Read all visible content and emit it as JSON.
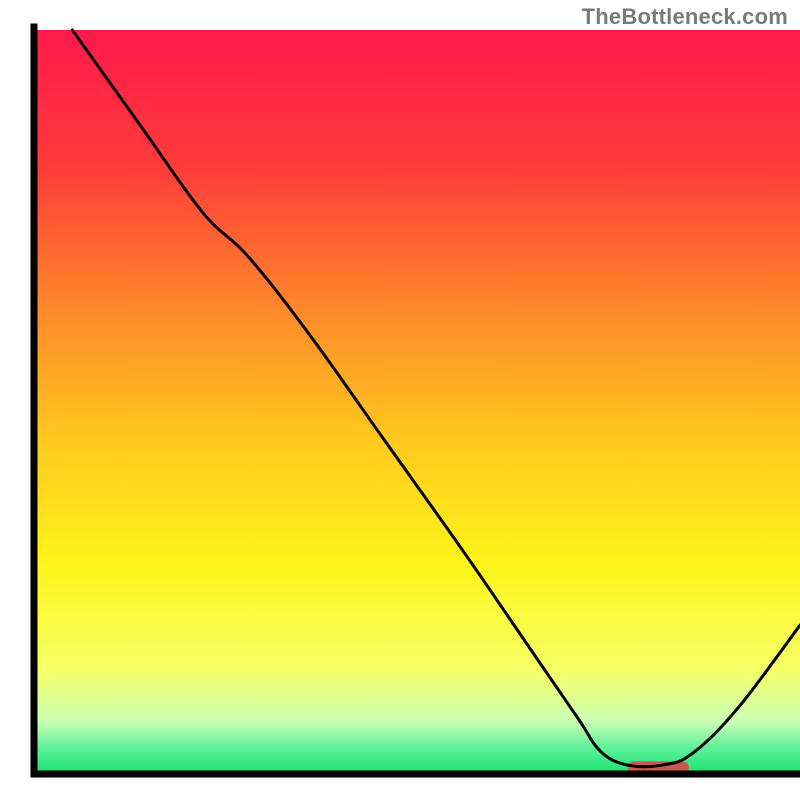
{
  "watermark": "TheBottleneck.com",
  "chart_data": {
    "type": "line",
    "title": "",
    "xlabel": "",
    "ylabel": "",
    "xlim": [
      0,
      100
    ],
    "ylim": [
      0,
      100
    ],
    "grid": false,
    "legend": false,
    "gradient_stops": [
      {
        "offset": 0.0,
        "color": "#ff1a4b"
      },
      {
        "offset": 0.18,
        "color": "#ff3a3a"
      },
      {
        "offset": 0.38,
        "color": "#ff8a2a"
      },
      {
        "offset": 0.55,
        "color": "#ffc81e"
      },
      {
        "offset": 0.72,
        "color": "#fff51a"
      },
      {
        "offset": 0.86,
        "color": "#f6ff66"
      },
      {
        "offset": 0.93,
        "color": "#c8ffb4"
      },
      {
        "offset": 0.965,
        "color": "#5ef09a"
      },
      {
        "offset": 1.0,
        "color": "#17e270"
      }
    ],
    "series": [
      {
        "name": "curve",
        "color": "#000000",
        "points": [
          {
            "x": 5.0,
            "y": 100.0
          },
          {
            "x": 14.0,
            "y": 87.0
          },
          {
            "x": 22.0,
            "y": 75.5
          },
          {
            "x": 28.0,
            "y": 69.5
          },
          {
            "x": 36.0,
            "y": 59.0
          },
          {
            "x": 46.0,
            "y": 44.5
          },
          {
            "x": 56.0,
            "y": 30.0
          },
          {
            "x": 65.0,
            "y": 16.5
          },
          {
            "x": 71.0,
            "y": 7.5
          },
          {
            "x": 74.0,
            "y": 3.0
          },
          {
            "x": 77.5,
            "y": 1.2
          },
          {
            "x": 82.0,
            "y": 1.2
          },
          {
            "x": 86.0,
            "y": 2.8
          },
          {
            "x": 92.0,
            "y": 9.0
          },
          {
            "x": 100.0,
            "y": 20.0
          }
        ]
      }
    ],
    "marker": {
      "name": "optimal-range",
      "color": "#c9594f",
      "x_start": 77.5,
      "x_end": 85.5,
      "y": 0.9,
      "thickness_y": 1.6
    }
  }
}
